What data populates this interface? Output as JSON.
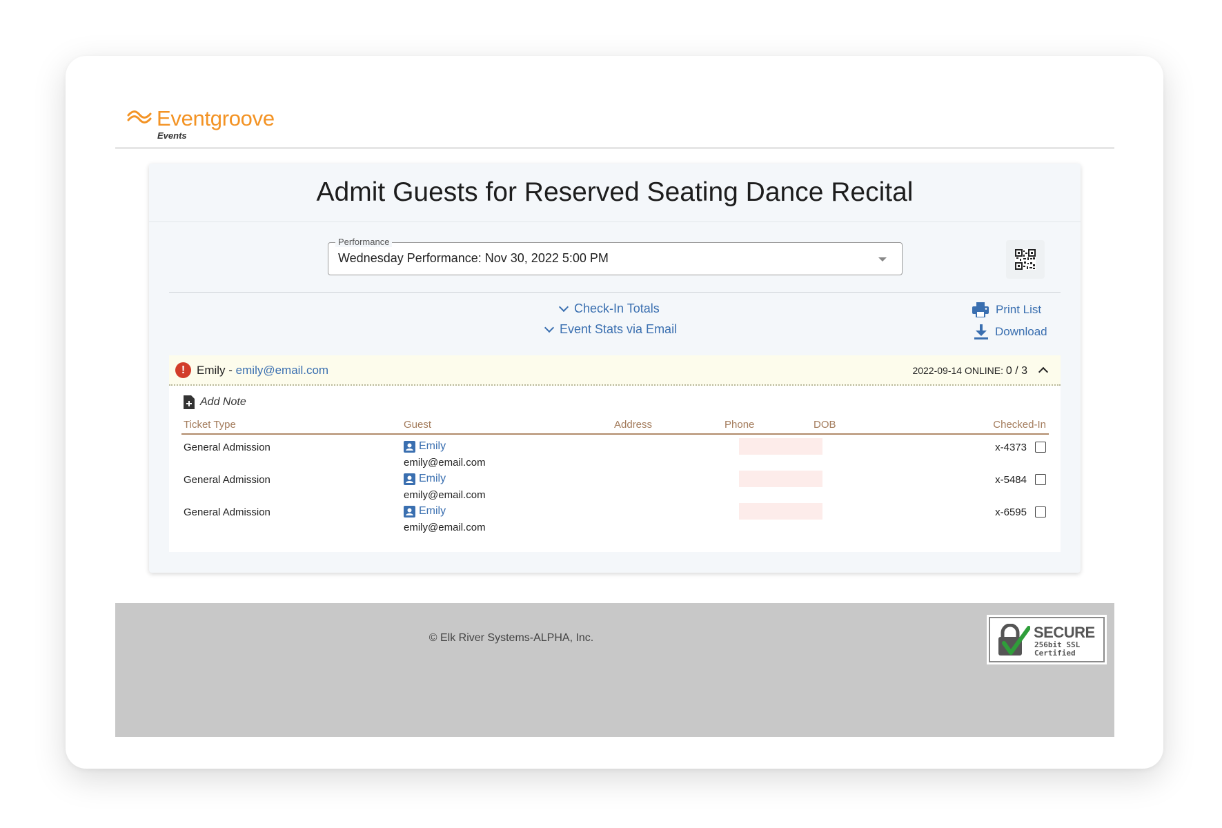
{
  "brand": {
    "name": "Eventgroove",
    "sub": "Events"
  },
  "page": {
    "title": "Admit Guests for Reserved Seating Dance Recital"
  },
  "performance": {
    "legend": "Performance",
    "selected": "Wednesday Performance: Nov 30, 2022 5:00 PM"
  },
  "links": {
    "checkin_totals": "Check-In Totals",
    "event_stats": "Event Stats via Email",
    "print_list": "Print List",
    "download": "Download"
  },
  "order": {
    "customer_name": "Emily",
    "separator": " - ",
    "customer_email": "emily@email.com",
    "status_date": "2022-09-14",
    "status_label": "ONLINE:",
    "status_count": "0 / 3",
    "add_note": "Add Note",
    "columns": [
      "Ticket Type",
      "Guest",
      "Address",
      "Phone",
      "DOB",
      "Checked-In"
    ],
    "rows": [
      {
        "ticket_type": "General Admission",
        "guest_name": "Emily",
        "guest_email": "emily@email.com",
        "ticket_no": "x-4373",
        "checked_in": false
      },
      {
        "ticket_type": "General Admission",
        "guest_name": "Emily",
        "guest_email": "emily@email.com",
        "ticket_no": "x-5484",
        "checked_in": false
      },
      {
        "ticket_type": "General Admission",
        "guest_name": "Emily",
        "guest_email": "emily@email.com",
        "ticket_no": "x-6595",
        "checked_in": false
      }
    ]
  },
  "footer": {
    "copyright": "© Elk River Systems-ALPHA, Inc.",
    "ssl_title": "SECURE",
    "ssl_line1": "256bit SSL",
    "ssl_line2": "Certified"
  },
  "icons": {
    "logo": "wave-logo-icon",
    "qr": "qr-code-icon",
    "print": "printer-icon",
    "download": "download-icon",
    "alert": "alert-icon",
    "note": "add-note-icon",
    "guest": "contact-card-icon",
    "ssl": "padlock-check-icon"
  },
  "colors": {
    "accent": "#f39324",
    "link": "#3a6fb0",
    "alert": "#d23c2a",
    "header_text": "#a37b5b"
  }
}
